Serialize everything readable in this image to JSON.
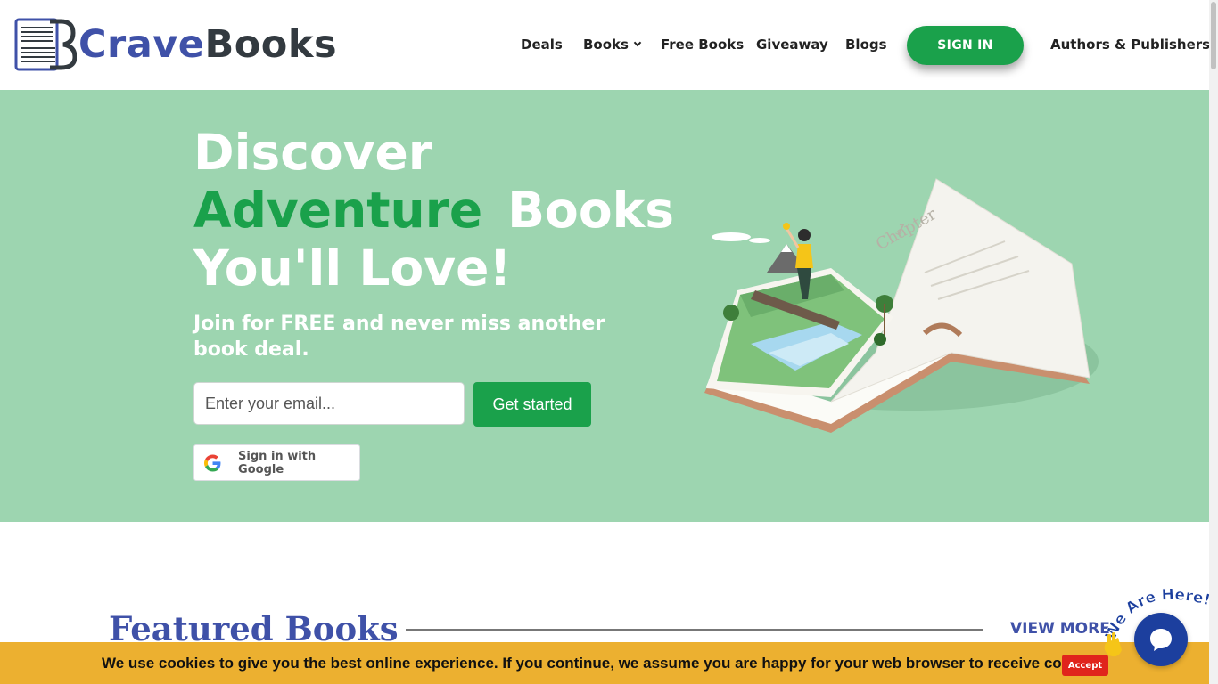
{
  "header": {
    "logo": {
      "part1": "Crave",
      "part2": "Books"
    },
    "nav": {
      "deals": "Deals",
      "books": "Books",
      "free_books": "Free Books",
      "giveaway": "Giveaway",
      "blogs": "Blogs",
      "sign_in": "SIGN IN",
      "authors": "Authors & Publishers"
    }
  },
  "hero": {
    "line1": "Discover",
    "accent": "Adventure",
    "line2_rest": "Books",
    "line3": "You'll Love!",
    "subtitle": "Join for FREE and never miss another book deal.",
    "email_placeholder": "Enter your email...",
    "get_started": "Get started",
    "google_signin": "Sign in with Google",
    "illustration_text": "1 Chapter"
  },
  "featured": {
    "title": "Featured Books",
    "view_more": "VIEW MORE"
  },
  "cookie": {
    "text": "We use cookies to give you the best online experience. If you continue, we assume you are happy for your web browser to receive cookies.",
    "accept": "Accept"
  },
  "chat": {
    "badge_text": "We Are Here!"
  },
  "colors": {
    "brand_blue": "#3f51a8",
    "brand_green": "#1aa14b",
    "hero_bg": "#9dd5b0",
    "cookie_bg": "#ecb030",
    "accept_red": "#e0241c",
    "chat_blue": "#1c3f9e"
  }
}
